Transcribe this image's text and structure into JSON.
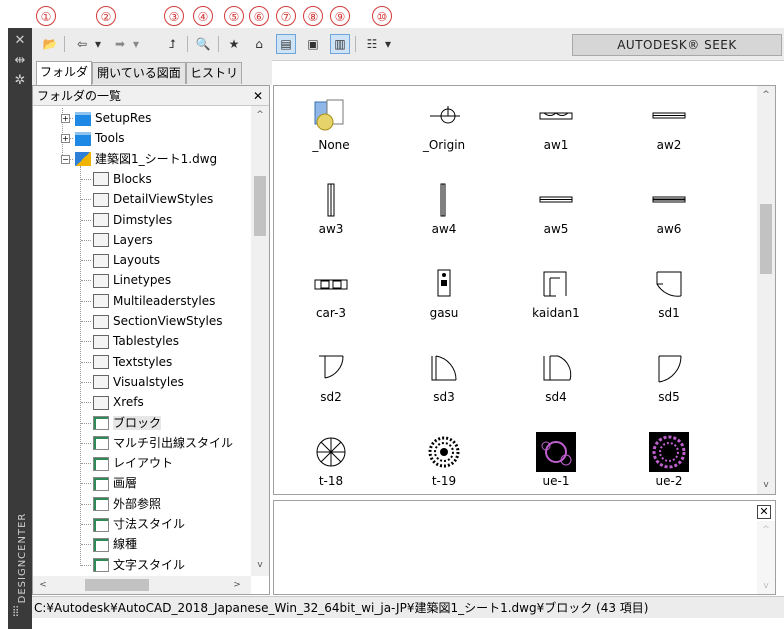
{
  "callouts": [
    "①",
    "②",
    "③",
    "④",
    "⑤",
    "⑥",
    "⑦",
    "⑧",
    "⑨",
    "⑩"
  ],
  "side_panel": {
    "title": "DESIGNCENTER",
    "close_glyph": "✕",
    "pin_glyph": "⇹",
    "props_glyph": "✲"
  },
  "toolbar": {
    "load_icon": "📂",
    "back_glyph": "⇦",
    "forward_glyph": "➡",
    "dropdown_glyph": "▾",
    "up_icon": "⮥",
    "search_icon": "🔍",
    "favorites_icon": "★",
    "home_icon": "⌂",
    "tree_toggle_icon": "▤",
    "preview_icon": "▣",
    "description_icon": "▥",
    "views_icon": "☷",
    "seek_label": "AUTODESK® SEEK"
  },
  "tabs": [
    {
      "label": "フォルダ",
      "active": true
    },
    {
      "label": "開いている図面",
      "active": false
    },
    {
      "label": "ヒストリ",
      "active": false
    }
  ],
  "tree": {
    "header": "フォルダの一覧",
    "close_glyph": "✕",
    "items": [
      {
        "label": "SetupRes",
        "level": 1,
        "icon": "folder-icon",
        "expander": "+"
      },
      {
        "label": "Tools",
        "level": 1,
        "icon": "folder-icon",
        "expander": "+"
      },
      {
        "label": "建築図1_シート1.dwg",
        "level": 1,
        "icon": "drawing-file-icon",
        "expander": "−"
      },
      {
        "label": "Blocks",
        "level": 2,
        "icon": "blocks-icon"
      },
      {
        "label": "DetailViewStyles",
        "level": 2,
        "icon": "detail-view-icon"
      },
      {
        "label": "Dimstyles",
        "level": 2,
        "icon": "dimstyle-icon"
      },
      {
        "label": "Layers",
        "level": 2,
        "icon": "layers-icon"
      },
      {
        "label": "Layouts",
        "level": 2,
        "icon": "layouts-icon"
      },
      {
        "label": "Linetypes",
        "level": 2,
        "icon": "linetypes-icon"
      },
      {
        "label": "Multileaderstyles",
        "level": 2,
        "icon": "multileader-icon"
      },
      {
        "label": "SectionViewStyles",
        "level": 2,
        "icon": "section-view-icon"
      },
      {
        "label": "Tablestyles",
        "level": 2,
        "icon": "tablestyle-icon"
      },
      {
        "label": "Textstyles",
        "level": 2,
        "icon": "textstyle-icon"
      },
      {
        "label": "Visualstyles",
        "level": 2,
        "icon": "visualstyle-icon"
      },
      {
        "label": "Xrefs",
        "level": 2,
        "icon": "xref-icon"
      },
      {
        "label": "ブロック",
        "level": 2,
        "icon": "generic-item-icon",
        "selected": true
      },
      {
        "label": "マルチ引出線スタイル",
        "level": 2,
        "icon": "generic-item-icon"
      },
      {
        "label": "レイアウト",
        "level": 2,
        "icon": "generic-item-icon"
      },
      {
        "label": "画層",
        "level": 2,
        "icon": "generic-item-icon"
      },
      {
        "label": "外部参照",
        "level": 2,
        "icon": "generic-item-icon"
      },
      {
        "label": "寸法スタイル",
        "level": 2,
        "icon": "generic-item-icon"
      },
      {
        "label": "線種",
        "level": 2,
        "icon": "generic-item-icon"
      },
      {
        "label": "文字スタイル",
        "level": 2,
        "icon": "generic-item-icon"
      }
    ]
  },
  "palette": {
    "items": [
      {
        "label": "_None",
        "icon": "none-block-icon"
      },
      {
        "label": "_Origin",
        "icon": "origin-block-icon"
      },
      {
        "label": "aw1",
        "icon": "window-block-icon"
      },
      {
        "label": "aw2",
        "icon": "window-block-icon"
      },
      {
        "label": "aw3",
        "icon": "window-vertical-block-icon"
      },
      {
        "label": "aw4",
        "icon": "window-vertical-block-icon"
      },
      {
        "label": "aw5",
        "icon": "window-block-icon"
      },
      {
        "label": "aw6",
        "icon": "window-block-icon"
      },
      {
        "label": "car-3",
        "icon": "car-block-icon"
      },
      {
        "label": "gasu",
        "icon": "gas-block-icon"
      },
      {
        "label": "kaidan1",
        "icon": "stair-block-icon"
      },
      {
        "label": "sd1",
        "icon": "door-block-icon"
      },
      {
        "label": "sd2",
        "icon": "door-block-icon"
      },
      {
        "label": "sd3",
        "icon": "door-block-icon"
      },
      {
        "label": "sd4",
        "icon": "door-block-icon"
      },
      {
        "label": "sd5",
        "icon": "door-block-icon"
      },
      {
        "label": "t-18",
        "icon": "tree-block-icon"
      },
      {
        "label": "t-19",
        "icon": "tree-block-icon"
      },
      {
        "label": "ue-1",
        "icon": "plant-block-icon"
      },
      {
        "label": "ue-2",
        "icon": "plant-block-icon"
      }
    ]
  },
  "preview": {
    "close_glyph": "✕"
  },
  "status_bar": {
    "path": "C:¥Autodesk¥AutoCAD_2018_Japanese_Win_32_64bit_wi_ja-JP¥建築図1_シート1.dwg¥ブロック (43 項目)"
  },
  "colors": {
    "accent": "#6ea6dc",
    "callout": "#d23a3a",
    "plant": "#b040c0"
  }
}
